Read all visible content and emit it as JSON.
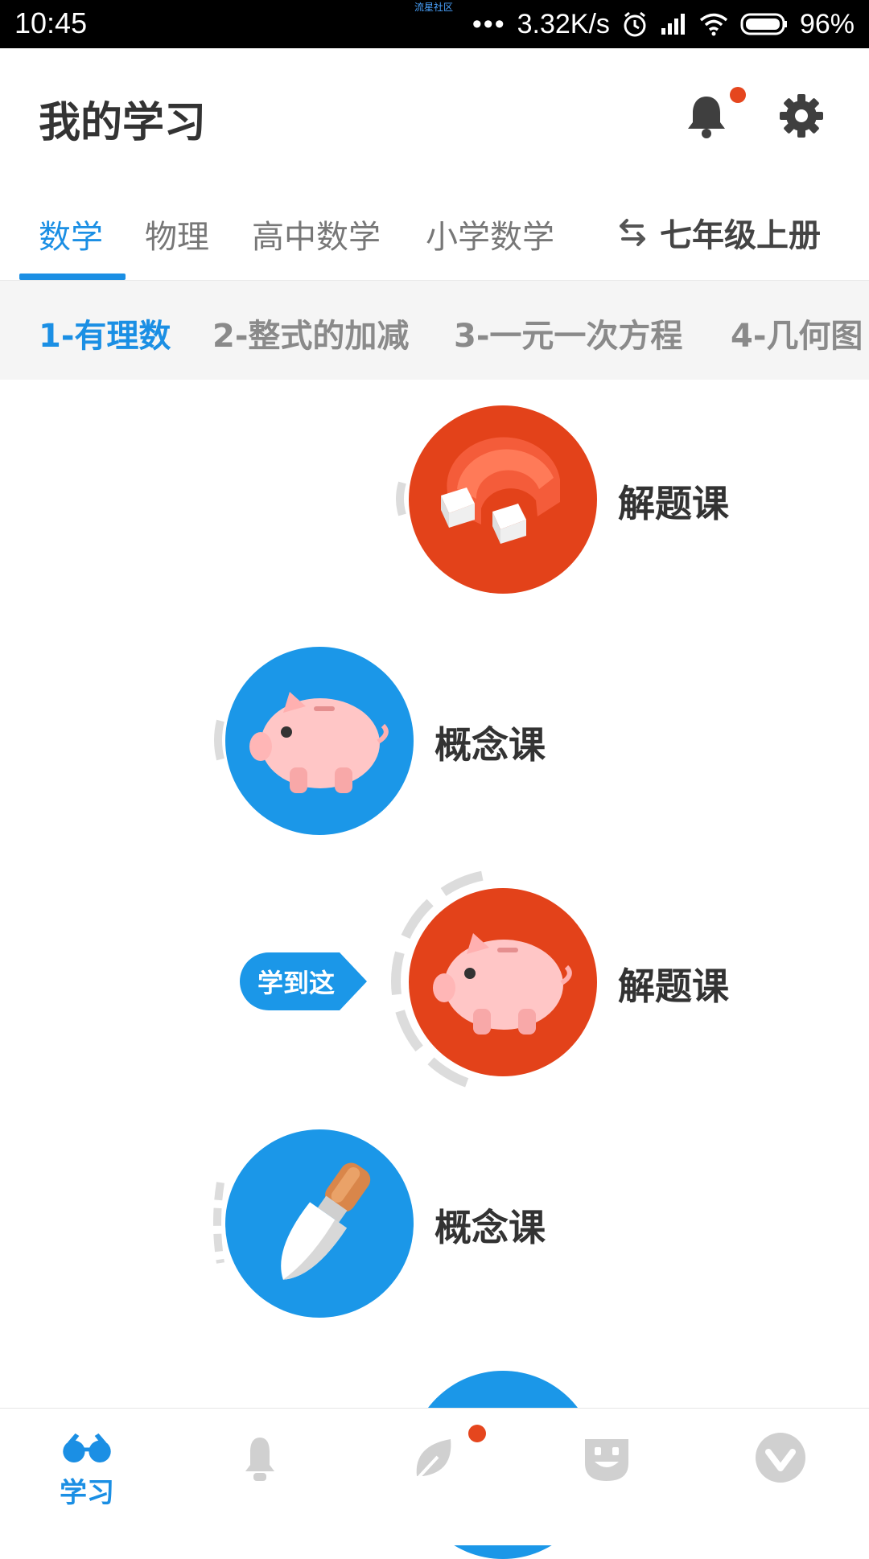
{
  "status_bar": {
    "time": "10:45",
    "carrier": "流星社区",
    "speed": "3.32K/s",
    "battery": "96%"
  },
  "header": {
    "title": "我的学习"
  },
  "subject_tabs": [
    "数学",
    "物理",
    "高中数学",
    "小学数学"
  ],
  "grade": "七年级上册",
  "chapters": [
    "1-有理数",
    "2-整式的加减",
    "3-一元一次方程",
    "4-几何图"
  ],
  "lessons": [
    {
      "label": "解题课",
      "color": "red",
      "icon": "magnet-icon"
    },
    {
      "label": "概念课",
      "color": "blue",
      "icon": "piggy-bank-icon"
    },
    {
      "label": "解题课",
      "color": "red",
      "icon": "piggy-bank-icon"
    },
    {
      "label": "概念课",
      "color": "blue",
      "icon": "brush-icon"
    }
  ],
  "progress_marker": "学到这",
  "bottom_nav": {
    "learn_label": "学习"
  },
  "colors": {
    "accent": "#1b8fe4",
    "red": "#e3421a",
    "blue": "#1b97e8",
    "notify": "#e5461e"
  }
}
